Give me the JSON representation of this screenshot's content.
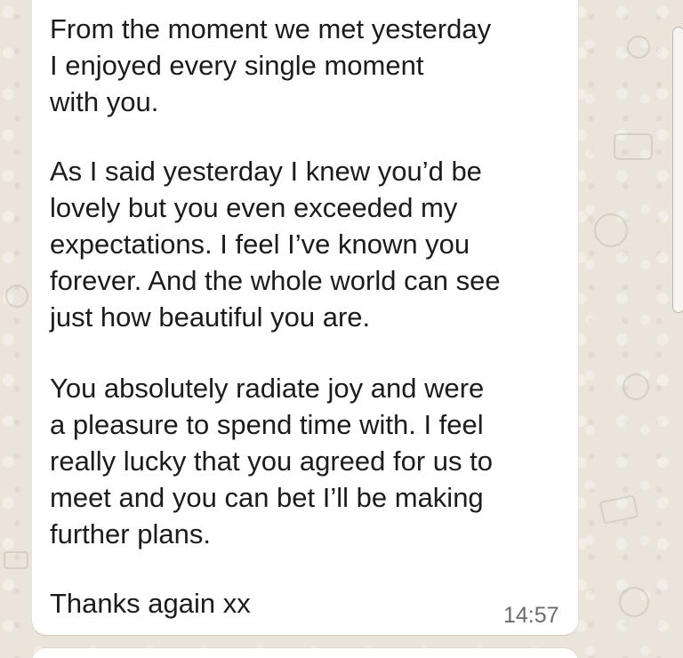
{
  "message": {
    "paragraphs": [
      "From the moment we met yesterday\nI enjoyed every single moment\nwith you.",
      "As I said yesterday I knew you’d be\nlovely but you even exceeded my\nexpectations. I feel I’ve known you\nforever. And the whole world can see\njust how beautiful you are.",
      "You absolutely radiate joy and were\na pleasure to spend time with. I feel\nreally lucky that you agreed for us to\nmeet and you can bet I’ll be making\nfurther plans.",
      "Thanks again xx"
    ],
    "time": "14:57"
  },
  "colors": {
    "wallpaper": "#ebe4da",
    "bubble": "#ffffff",
    "text": "#1c1c1c",
    "timestamp": "#6b6b6b"
  }
}
